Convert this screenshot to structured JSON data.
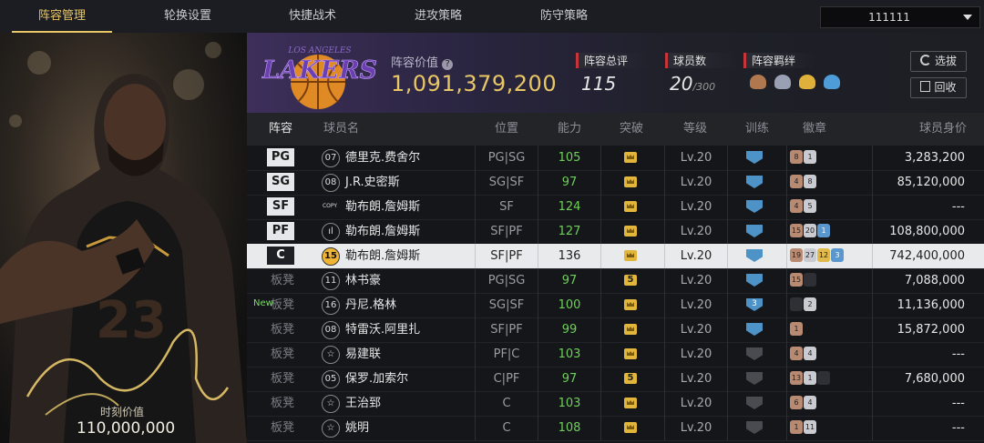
{
  "nav": {
    "tabs": [
      "阵容管理",
      "轮换设置",
      "快捷战术",
      "进攻策略",
      "防守策略"
    ],
    "account": "111111"
  },
  "portrait": {
    "value_label": "时刻价值",
    "value": "110,000,000"
  },
  "team": {
    "logo_text": "LAKERS",
    "logo_sub": "LOS ANGELES",
    "value_label": "阵容价值",
    "value": "1,091,379,200",
    "rating_label": "阵容总评",
    "rating": "115",
    "players_label": "球员数",
    "players": "20",
    "players_max": "/300",
    "bonds_label": "阵容羁绊",
    "btn_pick": "选拔",
    "btn_recycle": "回收"
  },
  "table": {
    "headers": [
      "阵容",
      "球员名",
      "位置",
      "能力",
      "突破",
      "等级",
      "训练",
      "徽章",
      "球员身价"
    ],
    "rows": [
      {
        "slot": "PG",
        "num": "07",
        "name": "德里克.费舍尔",
        "pos": "PG|SG",
        "ability": "105",
        "breakthrough": "",
        "level": "Lv.20",
        "training": "",
        "badges": [
          [
            "b",
            "8"
          ],
          [
            "s",
            "1"
          ]
        ],
        "value": "3,283,200",
        "sel": false
      },
      {
        "slot": "SG",
        "num": "08",
        "name": "J.R.史密斯",
        "pos": "SG|SF",
        "ability": "97",
        "breakthrough": "",
        "level": "Lv.20",
        "training": "",
        "badges": [
          [
            "b",
            "4"
          ],
          [
            "s",
            "8"
          ]
        ],
        "value": "85,120,000",
        "sel": false
      },
      {
        "slot": "SF",
        "num": "COPY",
        "name": "勒布朗.詹姆斯",
        "pos": "SF",
        "ability": "124",
        "breakthrough": "",
        "level": "Lv.20",
        "training": "",
        "badges": [
          [
            "b",
            "4"
          ],
          [
            "s",
            "5"
          ]
        ],
        "value": "---",
        "sel": false
      },
      {
        "slot": "PF",
        "num": "ıl",
        "name": "勒布朗.詹姆斯",
        "pos": "SF|PF",
        "ability": "127",
        "breakthrough": "",
        "level": "Lv.20",
        "training": "",
        "badges": [
          [
            "b",
            "15"
          ],
          [
            "s",
            "20"
          ],
          [
            "d",
            "1"
          ]
        ],
        "value": "108,800,000",
        "sel": false
      },
      {
        "slot": "C",
        "num": "15",
        "name": "勒布朗.詹姆斯",
        "pos": "SF|PF",
        "ability": "136",
        "breakthrough": "",
        "level": "Lv.20",
        "training": "",
        "badges": [
          [
            "b",
            "19"
          ],
          [
            "s",
            "27"
          ],
          [
            "g",
            "12"
          ],
          [
            "d",
            "3"
          ]
        ],
        "value": "742,400,000",
        "sel": true
      },
      {
        "slot": "板凳",
        "num": "11",
        "name": "林书豪",
        "pos": "PG|SG",
        "ability": "97",
        "breakthrough": "5",
        "level": "Lv.20",
        "training": "",
        "badges": [
          [
            "b",
            "15"
          ],
          [
            "x",
            "0"
          ]
        ],
        "value": "7,088,000",
        "sel": false
      },
      {
        "slot": "板凳",
        "num": "16",
        "name": "丹尼.格林",
        "pos": "SG|SF",
        "ability": "100",
        "breakthrough": "",
        "level": "Lv.20",
        "training": "3",
        "badges": [
          [
            "x",
            "0"
          ],
          [
            "s",
            "2"
          ]
        ],
        "value": "11,136,000",
        "sel": false
      },
      {
        "slot": "板凳",
        "num": "08",
        "name": "特雷沃.阿里扎",
        "pos": "SF|PF",
        "ability": "99",
        "breakthrough": "",
        "level": "Lv.20",
        "training": "",
        "badges": [
          [
            "b",
            "1"
          ]
        ],
        "value": "15,872,000",
        "sel": false
      },
      {
        "slot": "板凳",
        "num": "☆",
        "name": "易建联",
        "pos": "PF|C",
        "ability": "103",
        "breakthrough": "",
        "level": "Lv.20",
        "training": "",
        "badges": [
          [
            "b",
            "4"
          ],
          [
            "s",
            "4"
          ]
        ],
        "value": "---",
        "sel": false
      },
      {
        "slot": "板凳",
        "num": "05",
        "name": "保罗.加索尔",
        "pos": "C|PF",
        "ability": "97",
        "breakthrough": "5",
        "level": "Lv.20",
        "training": "",
        "badges": [
          [
            "b",
            "13"
          ],
          [
            "s",
            "1"
          ],
          [
            "x",
            "0"
          ]
        ],
        "value": "7,680,000",
        "sel": false
      },
      {
        "slot": "板凳",
        "num": "☆",
        "name": "王治郅",
        "pos": "C",
        "ability": "103",
        "breakthrough": "",
        "level": "Lv.20",
        "training": "",
        "badges": [
          [
            "b",
            "6"
          ],
          [
            "s",
            "4"
          ]
        ],
        "value": "---",
        "sel": false
      },
      {
        "slot": "板凳",
        "num": "☆",
        "name": "姚明",
        "pos": "C",
        "ability": "108",
        "breakthrough": "",
        "level": "Lv.20",
        "training": "",
        "badges": [
          [
            "b",
            "1"
          ],
          [
            "s",
            "11"
          ]
        ],
        "value": "---",
        "sel": false
      }
    ],
    "new_tag": "New"
  }
}
